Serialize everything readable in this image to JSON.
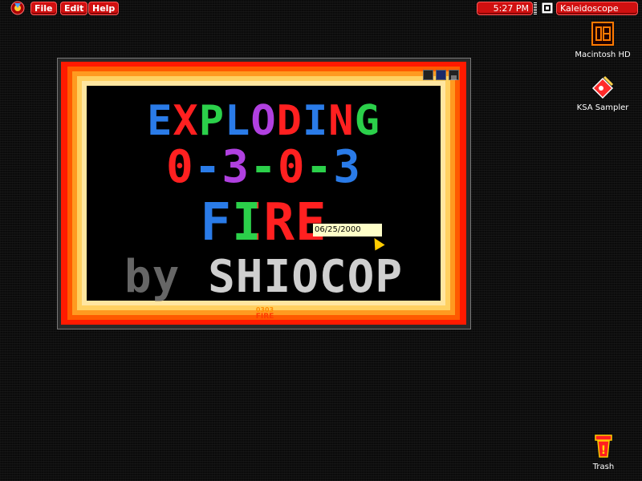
{
  "menubar": {
    "apple_icon": "apple-logo-icon",
    "items": [
      {
        "label": "File"
      },
      {
        "label": "Edit"
      },
      {
        "label": "Help"
      }
    ],
    "clock": "5:27 PM",
    "active_app": "Kaleidoscope",
    "app_icon": "application-switcher-icon"
  },
  "window": {
    "title_lines": [
      {
        "text": "EXPLODING"
      },
      {
        "text": "0-3-0-3"
      },
      {
        "text": "FIRE"
      },
      {
        "text": "by SHIOCOP"
      }
    ],
    "date": "06/25/2000",
    "logo_lines": [
      "0303",
      "FIRE"
    ],
    "buttons": [
      "close-box-icon",
      "zoom-box-icon",
      "collapse-box-icon"
    ]
  },
  "desktop": {
    "icons": [
      {
        "label": "Macintosh HD",
        "icon": "hard-drive-icon"
      },
      {
        "label": "KSA Sampler",
        "icon": "ksa-sampler-icon"
      },
      {
        "label": "Trash",
        "icon": "trash-icon"
      }
    ]
  },
  "colors": {
    "menu_red": "#d01010",
    "frame_red": "#ff1a00",
    "date_bg": "#ffffc8",
    "blue": "#2a7be8",
    "red": "#ff2020",
    "green": "#2bd04a",
    "purple": "#b040e0",
    "gray": "#b0b0b0"
  }
}
